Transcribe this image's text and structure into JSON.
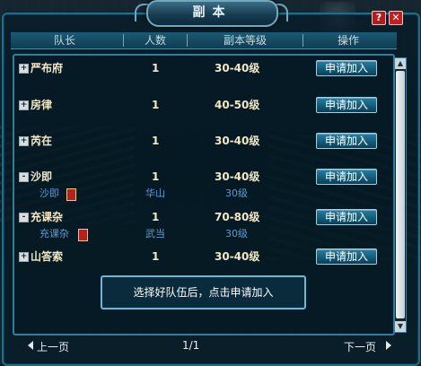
{
  "dialog": {
    "title": "副本"
  },
  "header": {
    "leader": "队长",
    "count": "人数",
    "level": "副本等级",
    "action": "操作"
  },
  "rows": [
    {
      "expander": "+",
      "name": "严布府",
      "count": "1",
      "level": "30-40级",
      "button": "申请加入"
    },
    {
      "expander": "+",
      "name": "房律",
      "count": "1",
      "level": "40-50级",
      "button": "申请加入"
    },
    {
      "expander": "+",
      "name": "芮在",
      "count": "1",
      "level": "30-40级",
      "button": "申请加入"
    },
    {
      "expander": "-",
      "name": "沙即",
      "count": "1",
      "level": "30-40级",
      "button": "申请加入",
      "member": {
        "name": "沙即",
        "school": "华山",
        "level": "30级"
      }
    },
    {
      "expander": "-",
      "name": "充课杂",
      "count": "1",
      "level": "70-80级",
      "button": "申请加入",
      "member": {
        "name": "充课杂",
        "school": "武当",
        "level": "30级"
      }
    },
    {
      "expander": "+",
      "name": "山答索",
      "count": "1",
      "level": "30-40级",
      "button": "申请加入"
    }
  ],
  "tip": "选择好队伍后，点击申请加入",
  "footer": {
    "prev": "上一页",
    "page": "1/1",
    "next": "下一页"
  },
  "icons": {
    "help": "?",
    "close": "✕",
    "scroll_up": "▲",
    "scroll_down": "▼"
  },
  "colors": {
    "accent": "#1e6d8a",
    "member_text": "#5c9cd8",
    "row_text": "#f3e7c5",
    "close_button": "#c31f1f"
  }
}
